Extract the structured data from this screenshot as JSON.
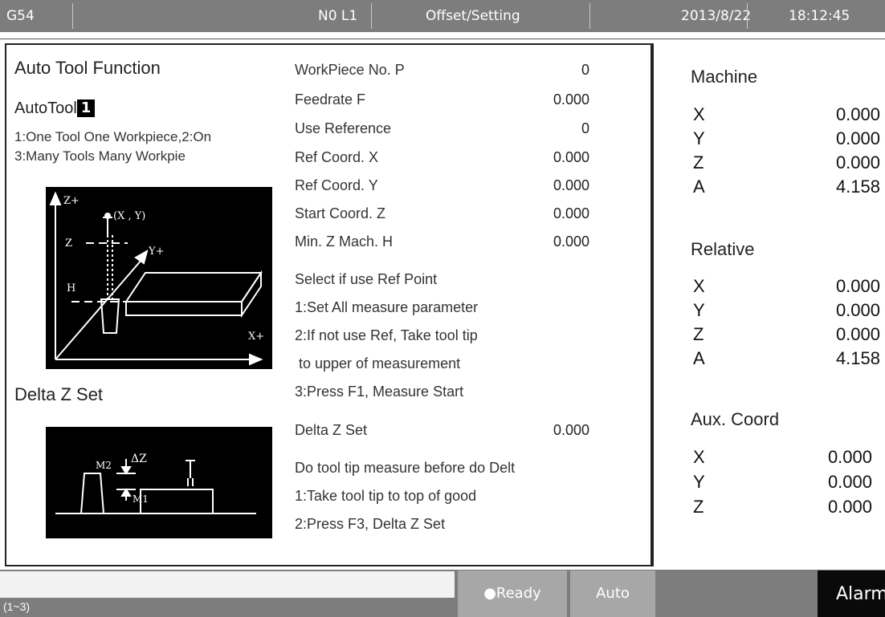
{
  "topbar": {
    "coord_system": "G54",
    "line_number": "N0 L1",
    "page_title": "Offset/Setting",
    "date": "2013/8/22",
    "time": "18:12:45"
  },
  "auto_tool": {
    "section_title": "Auto Tool Function",
    "mode_label": "AutoTool",
    "mode_value": "1",
    "options_line1": "1:One Tool One Workpiece,2:On",
    "options_line2": "3:Many Tools Many Workpie",
    "diagram": {
      "z_axis_label": "Z+",
      "point_label": "(X , Y)",
      "z_label": "Z",
      "y_axis_label": "Y+",
      "h_label": "H",
      "x_axis_label": "X+"
    }
  },
  "delta_z": {
    "section_title": "Delta Z Set",
    "diagram": {
      "m2_label": "M2",
      "delta_label": "ΔZ",
      "m1_label": "M1"
    }
  },
  "parameters": [
    {
      "label": "WorkPiece No. P",
      "value": "0"
    },
    {
      "label": "Feedrate F",
      "value": "0.000"
    },
    {
      "label": "Use Reference",
      "value": "0"
    },
    {
      "label": "Ref Coord. X",
      "value": "0.000"
    },
    {
      "label": "Ref Coord. Y",
      "value": "0.000"
    },
    {
      "label": "Start Coord. Z",
      "value": "0.000"
    },
    {
      "label": "Min. Z Mach. H",
      "value": "0.000"
    }
  ],
  "ref_instructions": [
    "Select if use Ref Point",
    "1:Set All measure parameter",
    "2:If not use Ref, Take tool tip",
    " to upper of measurement",
    "3:Press F1, Measure Start"
  ],
  "delta_z_param": {
    "label": "Delta Z Set",
    "value": "0.000"
  },
  "delta_instructions": [
    "Do tool tip measure before do Delt",
    "1:Take tool tip to top of good",
    "2:Press F3, Delta Z Set"
  ],
  "machine": {
    "title": "Machine",
    "axes": [
      {
        "axis": "X",
        "value": "0.000"
      },
      {
        "axis": "Y",
        "value": "0.000"
      },
      {
        "axis": "Z",
        "value": "0.000"
      },
      {
        "axis": "A",
        "value": "4.158"
      }
    ]
  },
  "relative": {
    "title": "Relative",
    "axes": [
      {
        "axis": "X",
        "value": "0.000"
      },
      {
        "axis": "Y",
        "value": "0.000"
      },
      {
        "axis": "Z",
        "value": "0.000"
      },
      {
        "axis": "A",
        "value": "4.158"
      }
    ]
  },
  "aux": {
    "title": "Aux. Coord",
    "axes": [
      {
        "axis": "X",
        "value": "0.000"
      },
      {
        "axis": "Y",
        "value": "0.000"
      },
      {
        "axis": "Z",
        "value": "0.000"
      }
    ]
  },
  "bottombar": {
    "input_value": "",
    "input_hint": "(1~3)",
    "status_ready": "●Ready",
    "status_mode": "Auto",
    "alarm": "Alarm"
  }
}
